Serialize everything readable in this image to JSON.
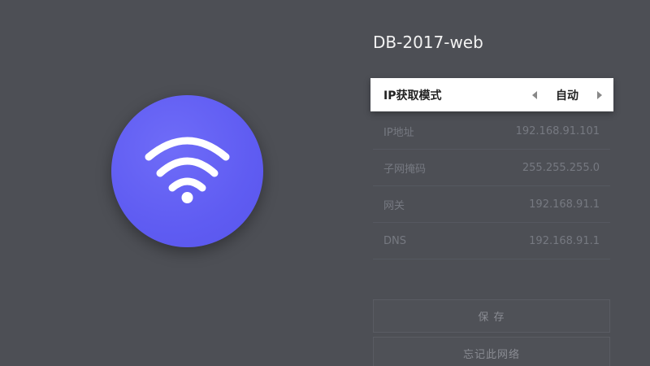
{
  "network": {
    "name": "DB-2017-web"
  },
  "ip_mode": {
    "label": "IP获取模式",
    "value": "自动"
  },
  "fields": [
    {
      "label": "IP地址",
      "value": "192.168.91.101"
    },
    {
      "label": "子网掩码",
      "value": "255.255.255.0"
    },
    {
      "label": "网关",
      "value": "192.168.91.1"
    },
    {
      "label": "DNS",
      "value": "192.168.91.1"
    }
  ],
  "buttons": {
    "save": "保 存",
    "forget": "忘记此网络"
  },
  "colors": {
    "background": "#4d4f55",
    "wifi_circle": "#5f5cf2",
    "selected_row": "#ffffff"
  },
  "icons": {
    "wifi": "wifi-icon",
    "left": "chevron-left-icon",
    "right": "chevron-right-icon"
  }
}
